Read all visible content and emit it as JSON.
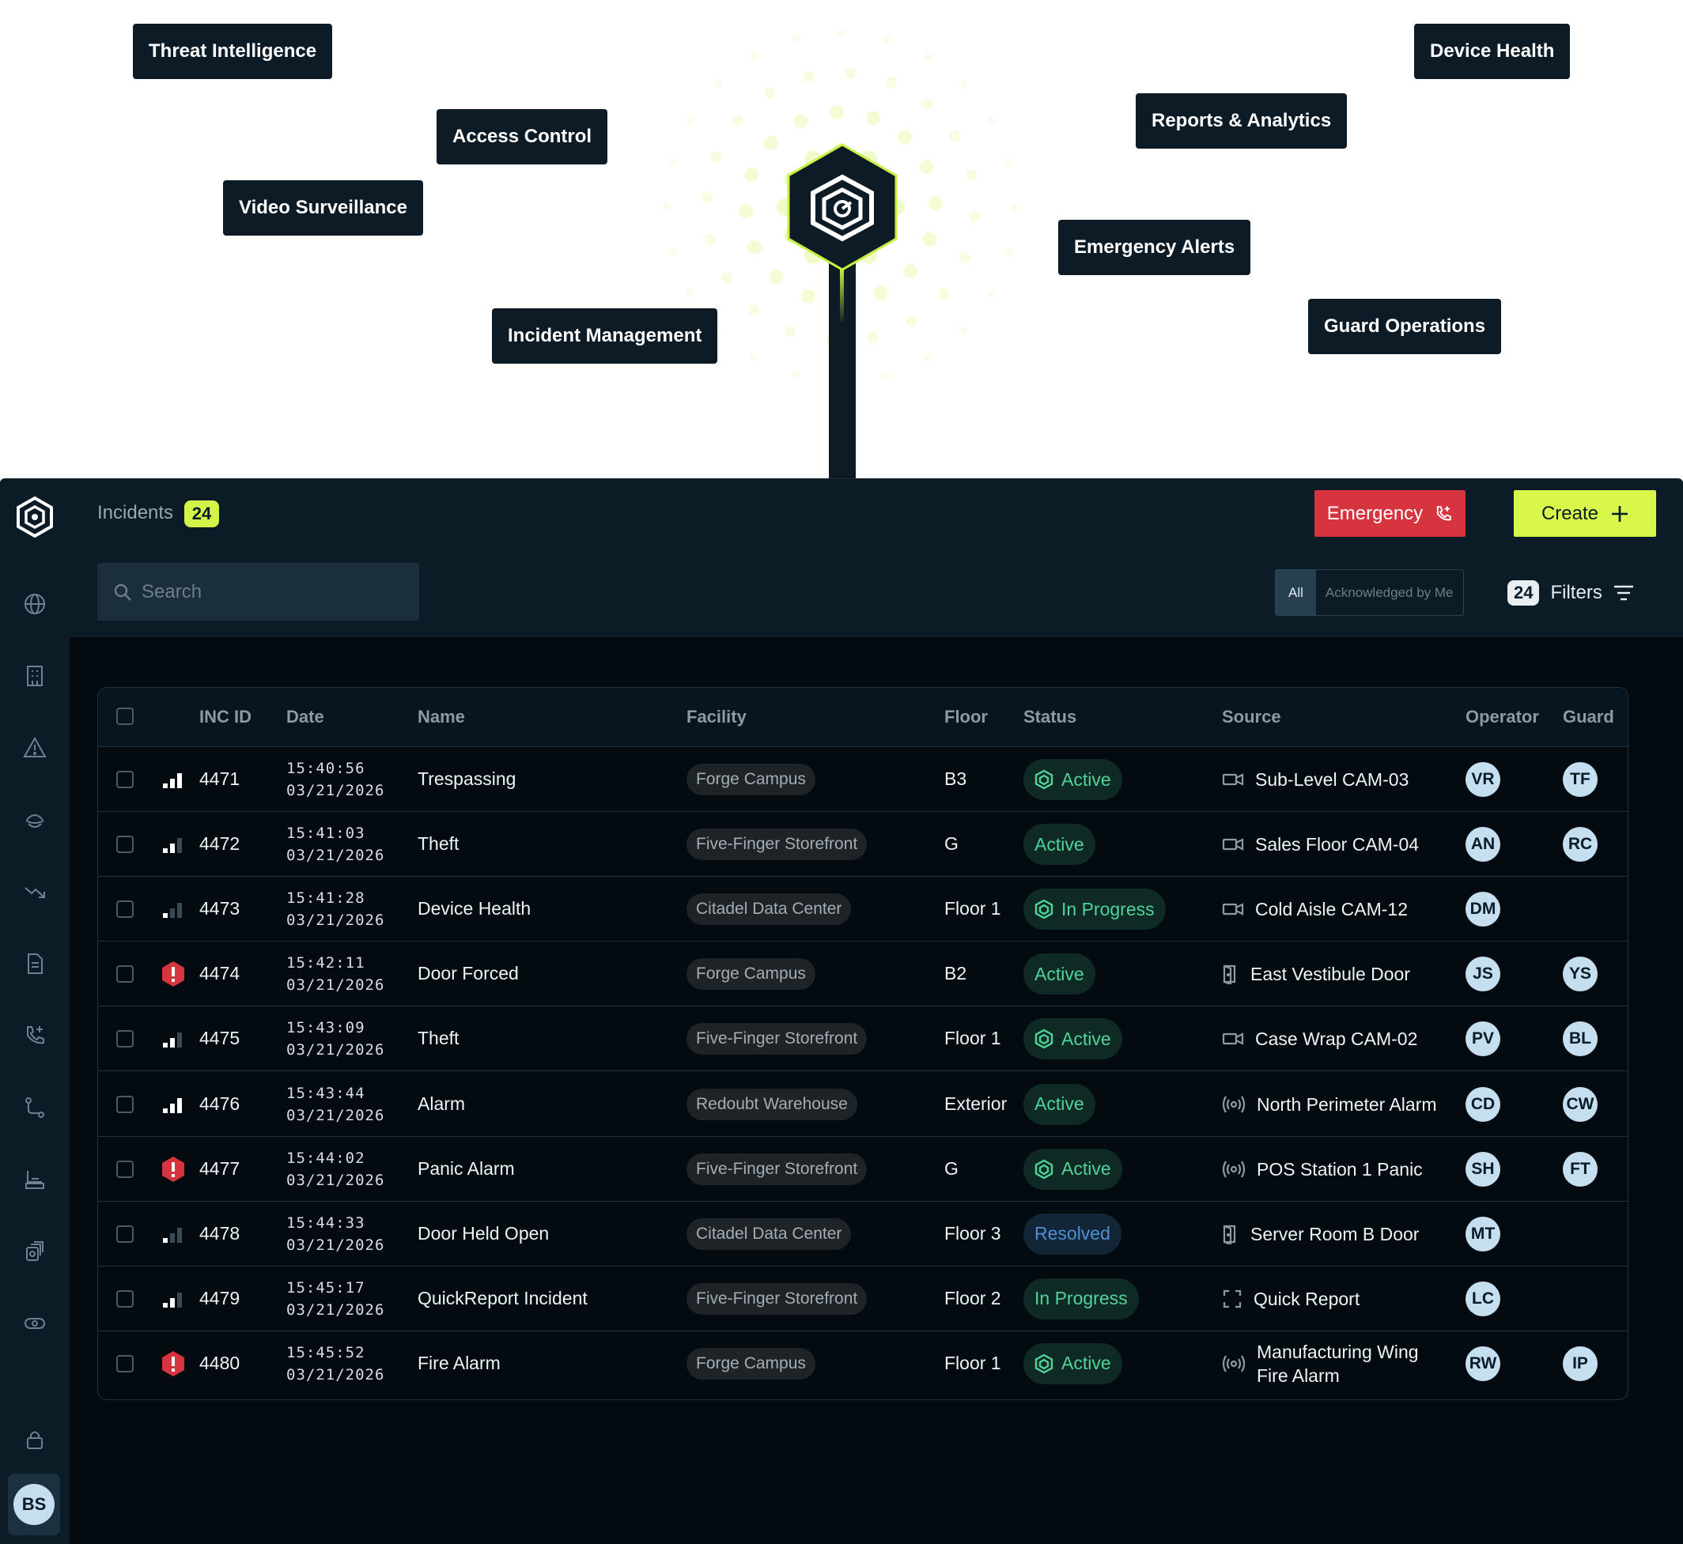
{
  "hero": {
    "labels": [
      {
        "id": "threat",
        "text": "Threat Intelligence"
      },
      {
        "id": "access",
        "text": "Access Control"
      },
      {
        "id": "video",
        "text": "Video Surveillance"
      },
      {
        "id": "incident",
        "text": "Incident Management"
      },
      {
        "id": "device",
        "text": "Device Health"
      },
      {
        "id": "reports",
        "text": "Reports & Analytics"
      },
      {
        "id": "emergency",
        "text": "Emergency Alerts"
      },
      {
        "id": "guard",
        "text": "Guard Operations"
      }
    ],
    "accent_color": "#c8f040",
    "node_color": "#0c1b26"
  },
  "sidebar": {
    "icons": [
      "globe-icon",
      "building-icon",
      "warning-icon",
      "guard-hat-icon",
      "trend-down-icon",
      "document-icon",
      "phone-plus-icon",
      "route-icon",
      "reception-icon",
      "speaker-icon",
      "camera-icon"
    ],
    "lock_icon": "lock-icon",
    "user_initials": "BS"
  },
  "header": {
    "title": "Incidents",
    "count": "24",
    "emergency_label": "Emergency",
    "create_label": "Create"
  },
  "toolbar": {
    "search_placeholder": "Search",
    "seg_all": "All",
    "seg_ack": "Acknowledged by Me",
    "filter_count": "24",
    "filter_label": "Filters"
  },
  "table": {
    "headers": {
      "inc_id": "INC ID",
      "date": "Date",
      "name": "Name",
      "facility": "Facility",
      "floor": "Floor",
      "status": "Status",
      "source": "Source",
      "operator": "Operator",
      "guard": "Guard"
    },
    "rows": [
      {
        "priority": "high",
        "id": "4471",
        "time": "15:40:56",
        "date": "03/21/2026",
        "name": "Trespassing",
        "facility": "Forge Campus",
        "floor": "B3",
        "status": "Active",
        "status_kind": "active",
        "status_icon": true,
        "source_icon": "camera-icon",
        "source": "Sub-Level CAM-03",
        "operator": "VR",
        "guard": "TF"
      },
      {
        "priority": "medium",
        "id": "4472",
        "time": "15:41:03",
        "date": "03/21/2026",
        "name": "Theft",
        "facility": "Five-Finger Storefront",
        "floor": "G",
        "status": "Active",
        "status_kind": "active",
        "status_icon": false,
        "source_icon": "camera-icon",
        "source": "Sales Floor CAM-04",
        "operator": "AN",
        "guard": "RC"
      },
      {
        "priority": "low",
        "id": "4473",
        "time": "15:41:28",
        "date": "03/21/2026",
        "name": "Device Health",
        "facility": "Citadel Data Center",
        "floor": "Floor 1",
        "status": "In Progress",
        "status_kind": "progress",
        "status_icon": true,
        "source_icon": "camera-icon",
        "source": "Cold Aisle CAM-12",
        "operator": "DM",
        "guard": ""
      },
      {
        "priority": "critical",
        "id": "4474",
        "time": "15:42:11",
        "date": "03/21/2026",
        "name": "Door Forced",
        "facility": "Forge Campus",
        "floor": "B2",
        "status": "Active",
        "status_kind": "active",
        "status_icon": false,
        "source_icon": "door-icon",
        "source": "East Vestibule Door",
        "operator": "JS",
        "guard": "YS"
      },
      {
        "priority": "medium",
        "id": "4475",
        "time": "15:43:09",
        "date": "03/21/2026",
        "name": "Theft",
        "facility": "Five-Finger Storefront",
        "floor": "Floor 1",
        "status": "Active",
        "status_kind": "active",
        "status_icon": true,
        "source_icon": "camera-icon",
        "source": "Case Wrap CAM-02",
        "operator": "PV",
        "guard": "BL"
      },
      {
        "priority": "high",
        "id": "4476",
        "time": "15:43:44",
        "date": "03/21/2026",
        "name": "Alarm",
        "facility": "Redoubt Warehouse",
        "floor": "Exterior",
        "status": "Active",
        "status_kind": "active",
        "status_icon": false,
        "source_icon": "alarm-icon",
        "source": "North Perimeter Alarm",
        "operator": "CD",
        "guard": "CW"
      },
      {
        "priority": "critical",
        "id": "4477",
        "time": "15:44:02",
        "date": "03/21/2026",
        "name": "Panic Alarm",
        "facility": "Five-Finger Storefront",
        "floor": "G",
        "status": "Active",
        "status_kind": "active",
        "status_icon": true,
        "source_icon": "alarm-icon",
        "source": "POS Station 1 Panic",
        "operator": "SH",
        "guard": "FT"
      },
      {
        "priority": "low",
        "id": "4478",
        "time": "15:44:33",
        "date": "03/21/2026",
        "name": "Door Held Open",
        "facility": "Citadel Data Center",
        "floor": "Floor 3",
        "status": "Resolved",
        "status_kind": "resolved",
        "status_icon": false,
        "source_icon": "door-icon",
        "source": "Server Room B Door",
        "operator": "MT",
        "guard": ""
      },
      {
        "priority": "medium",
        "id": "4479",
        "time": "15:45:17",
        "date": "03/21/2026",
        "name": "QuickReport Incident",
        "facility": "Five-Finger Storefront",
        "floor": "Floor 2",
        "status": "In Progress",
        "status_kind": "progress",
        "status_icon": false,
        "source_icon": "quick-report-icon",
        "source": "Quick Report",
        "operator": "LC",
        "guard": ""
      },
      {
        "priority": "critical",
        "id": "4480",
        "time": "15:45:52",
        "date": "03/21/2026",
        "name": "Fire Alarm",
        "facility": "Forge Campus",
        "floor": "Floor 1",
        "status": "Active",
        "status_kind": "active",
        "status_icon": true,
        "source_icon": "alarm-icon",
        "source": "Manufacturing Wing Fire Alarm",
        "source_lines": [
          "Manufacturing Wing",
          "Fire Alarm"
        ],
        "operator": "RW",
        "guard": "IP"
      }
    ]
  }
}
